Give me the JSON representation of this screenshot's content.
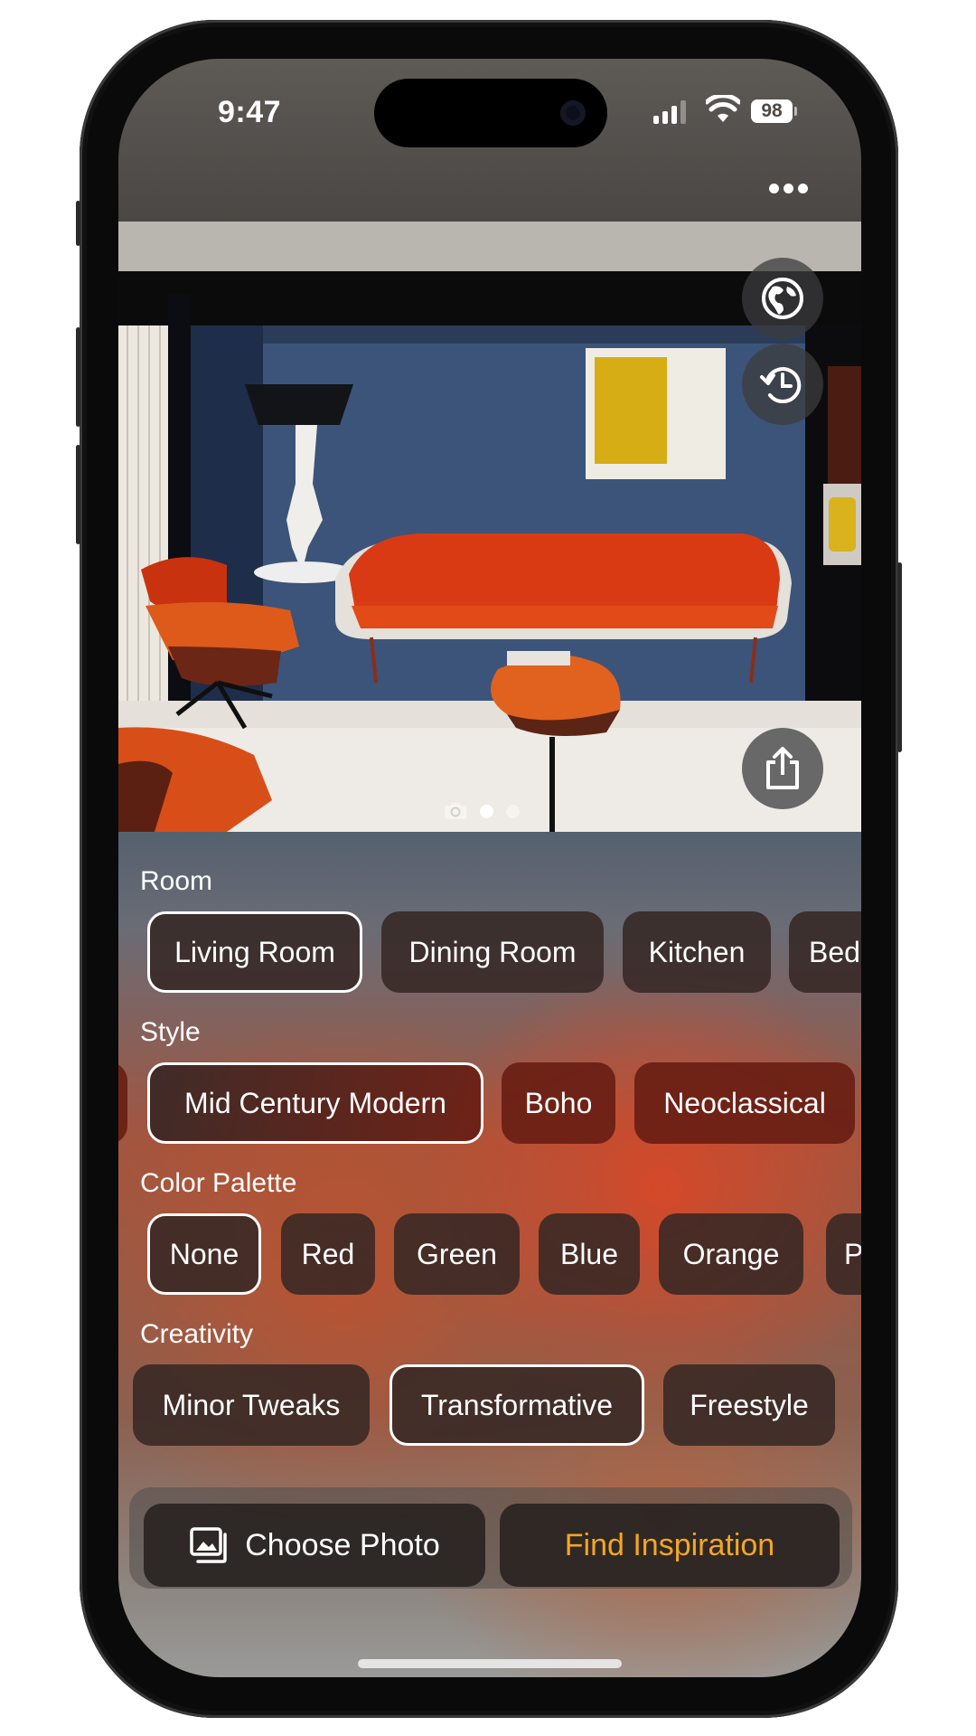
{
  "status_bar": {
    "time": "9:47",
    "battery": "98",
    "icons": [
      "cellular-signal-icon",
      "wifi-icon",
      "battery-icon"
    ]
  },
  "header": {
    "more_icon": "ellipsis-icon"
  },
  "hero": {
    "image_description": "Mid century modern living room with orange sofa, lounge chairs, blue wall, black floor lamp and yellow framed art",
    "buttons": [
      "globe-icon",
      "history-icon",
      "share-icon"
    ],
    "pager": {
      "camera_icon": "camera-icon",
      "page_count": 2,
      "active_index": 0
    }
  },
  "sections": {
    "room": {
      "label": "Room",
      "options": [
        "Living Room",
        "Dining Room",
        "Kitchen",
        "Bedroom"
      ],
      "selected": "Living Room"
    },
    "style": {
      "label": "Style",
      "options": [
        "",
        "Mid Century Modern",
        "Boho",
        "Neoclassical"
      ],
      "selected": "Mid Century Modern"
    },
    "color_palette": {
      "label": "Color Palette",
      "options": [
        "None",
        "Red",
        "Green",
        "Blue",
        "Orange",
        "P"
      ],
      "selected": "None"
    },
    "creativity": {
      "label": "Creativity",
      "options": [
        "Minor Tweaks",
        "Transformative",
        "Freestyle"
      ],
      "selected": "Transformative"
    }
  },
  "actions": {
    "choose_photo": "Choose Photo",
    "find_inspiration": "Find Inspiration"
  },
  "colors": {
    "accent": "#F5A623",
    "chip_selected_border": "#FFFFFF"
  }
}
